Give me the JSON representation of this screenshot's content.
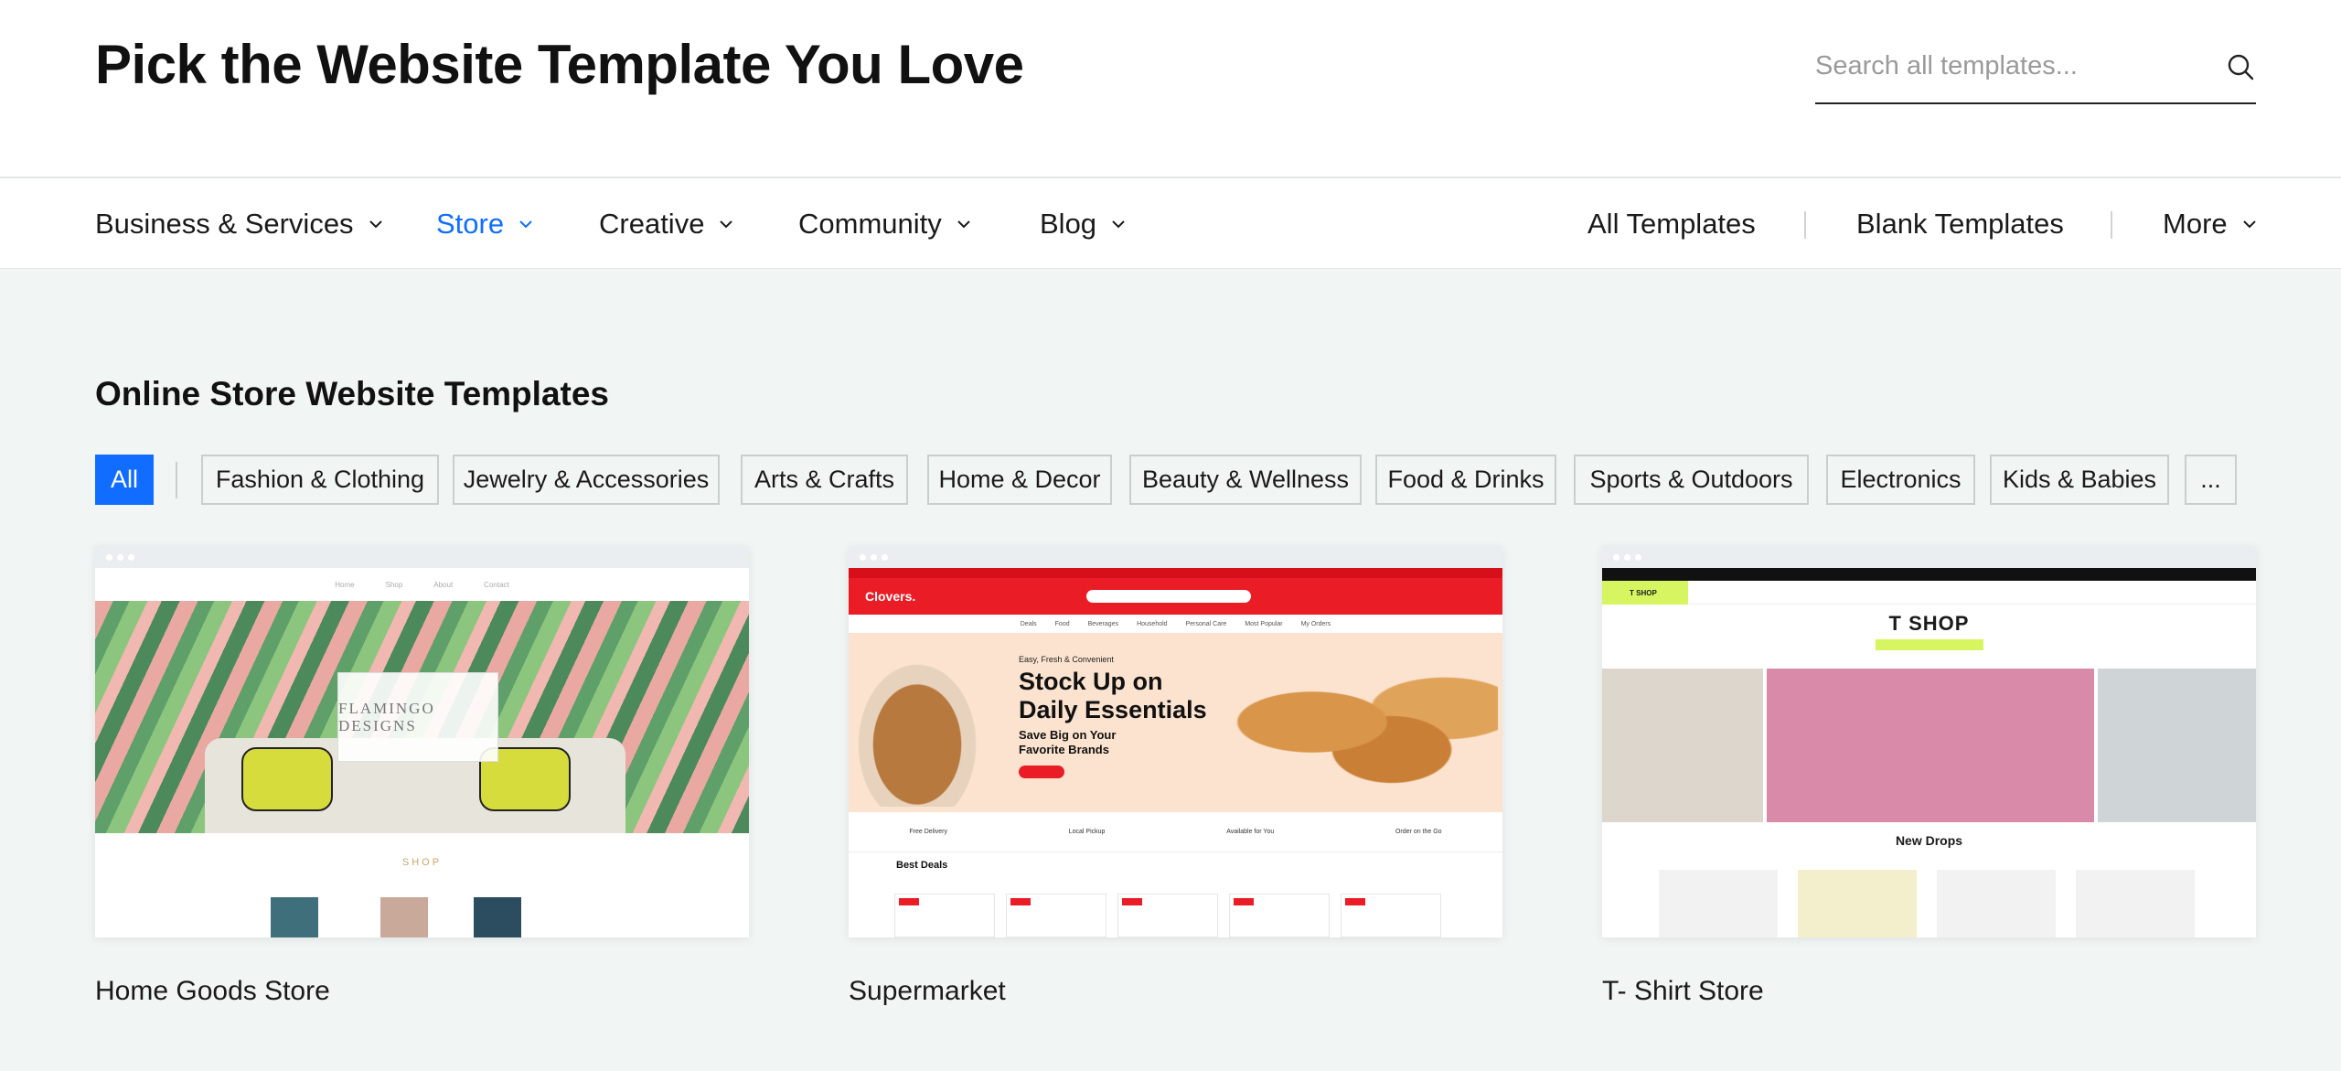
{
  "header": {
    "title": "Pick the Website Template You Love",
    "search_placeholder": "Search all templates...",
    "search_icon": "search-icon"
  },
  "nav": {
    "categories": [
      {
        "label": "Business & Services",
        "active": false
      },
      {
        "label": "Store",
        "active": true
      },
      {
        "label": "Creative",
        "active": false
      },
      {
        "label": "Community",
        "active": false
      },
      {
        "label": "Blog",
        "active": false
      }
    ],
    "right": {
      "all_templates": "All Templates",
      "blank_templates": "Blank Templates",
      "more": "More"
    }
  },
  "section": {
    "title": "Online Store Website Templates",
    "filters": [
      "All",
      "Fashion & Clothing",
      "Jewelry & Accessories",
      "Arts & Crafts",
      "Home & Decor",
      "Beauty & Wellness",
      "Food & Drinks",
      "Sports & Outdoors",
      "Electronics",
      "Kids & Babies",
      "..."
    ],
    "active_filter": "All"
  },
  "templates": [
    {
      "name": "Home Goods Store",
      "preview": {
        "brand": "FLAMINGO DESIGNS",
        "section": "SHOP"
      }
    },
    {
      "name": "Supermarket",
      "preview": {
        "logo": "Clovers.",
        "eyebrow": "Easy, Fresh & Convenient",
        "headline_1": "Stock Up on",
        "headline_2": "Daily Essentials",
        "sub_1": "Save Big on Your",
        "sub_2": "Favorite Brands",
        "features": [
          "Free Delivery",
          "Local Pickup",
          "Available for You",
          "Order on the Go"
        ],
        "deals": "Best Deals"
      }
    },
    {
      "name": "T- Shirt Store",
      "preview": {
        "logo": "T SHOP",
        "title": "T SHOP",
        "drops": "New Drops"
      }
    }
  ],
  "colors": {
    "accent": "#116dff",
    "page_bg": "#f1f5f4",
    "supermarket_red": "#ea1c26",
    "tshop_lime": "#d7f560"
  }
}
